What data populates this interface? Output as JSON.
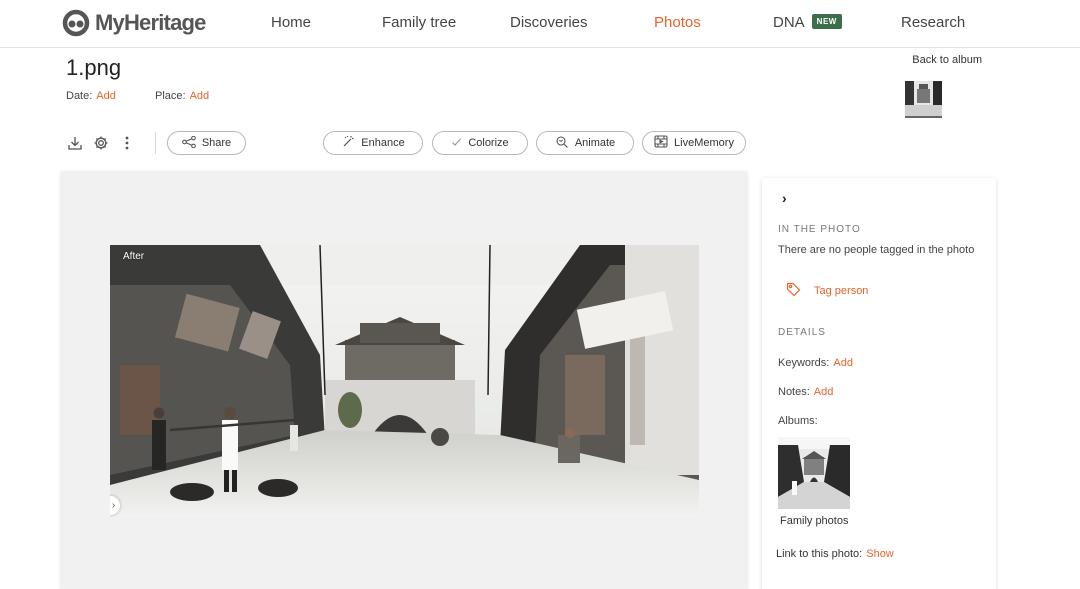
{
  "brand": {
    "name": "MyHeritage"
  },
  "nav": {
    "items": [
      {
        "label": "Home"
      },
      {
        "label": "Family tree"
      },
      {
        "label": "Discoveries"
      },
      {
        "label": "Photos"
      },
      {
        "label": "DNA",
        "badge": "NEW"
      },
      {
        "label": "Research"
      }
    ]
  },
  "photo": {
    "title": "1.png",
    "date_label": "Date:",
    "date_action": "Add",
    "place_label": "Place:",
    "place_action": "Add",
    "back_label": "Back to album",
    "compare_label": "After"
  },
  "toolbar": {
    "share": "Share",
    "enhance": "Enhance",
    "colorize": "Colorize",
    "animate": "Animate",
    "livememory": "LiveMemory"
  },
  "side": {
    "in_photo_heading": "IN THE PHOTO",
    "no_people_text": "There are no people tagged in the photo",
    "tag_person": "Tag person",
    "details_heading": "DETAILS",
    "keywords_label": "Keywords:",
    "keywords_action": "Add",
    "notes_label": "Notes:",
    "notes_action": "Add",
    "albums_label": "Albums:",
    "album_name": "Family photos",
    "link_label": "Link to this photo:",
    "link_action": "Show"
  },
  "colors": {
    "accent": "#e8632b",
    "badge": "#3c6e4b"
  },
  "icons": [
    "download-icon",
    "gear-icon",
    "more-vertical-icon",
    "share-icon",
    "magic-wand-icon",
    "check-icon",
    "animate-icon",
    "film-icon",
    "tag-icon",
    "chevron-right-icon"
  ]
}
